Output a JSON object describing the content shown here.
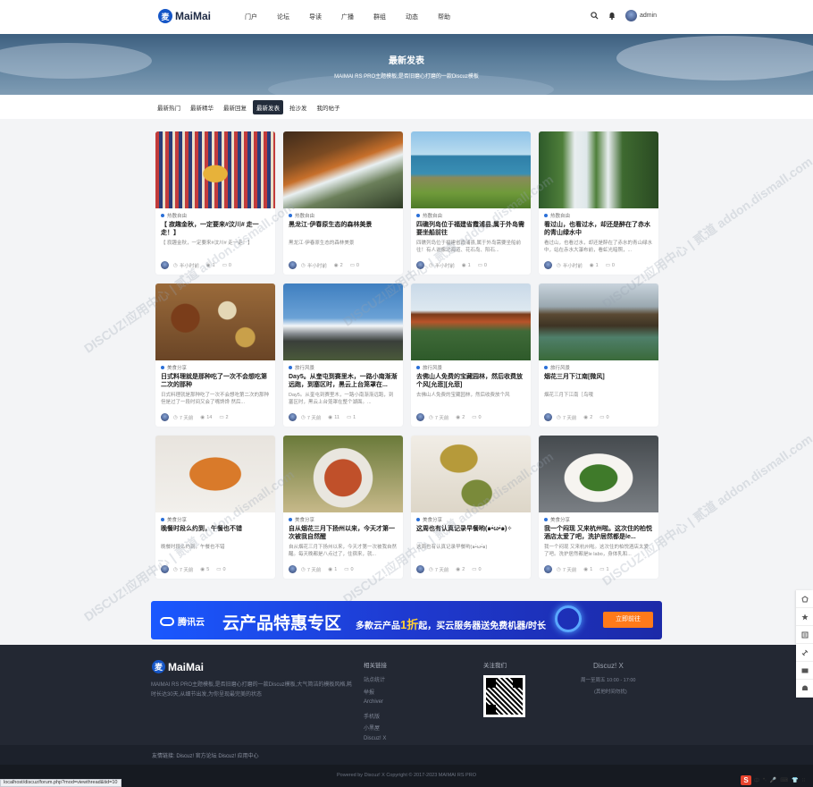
{
  "header": {
    "logo_text": "MaiMai",
    "logo_badge": "麦",
    "nav": [
      "门户",
      "论坛",
      "导读",
      "广播",
      "群组",
      "动态",
      "帮助"
    ],
    "user": "admin"
  },
  "banner": {
    "title": "最新发表",
    "subtitle": "MAIMAI RS PRO主题模板,是否旧磨心打磨的一款Discuz模板"
  },
  "tabs": [
    "最新热门",
    "最新精华",
    "最新回复",
    "最新发表",
    "抢沙发",
    "我的帖子"
  ],
  "active_tab": "最新发表",
  "cards": [
    {
      "category": "热敷自由",
      "title": "【 寂趣金秋，一定要来#汶川# 走一走！】",
      "excerpt": "【 寂趣金秋，一定要来#汶川# 走一走！】",
      "time": "半小时前",
      "views": "1",
      "replies": "0"
    },
    {
      "category": "热敷自由",
      "title": "黑龙江·伊春原生态的森林美景",
      "excerpt": "黑龙江·伊春原生态的森林美景",
      "time": "半小时前",
      "views": "2",
      "replies": "0"
    },
    {
      "category": "热敷自由",
      "title": "四礁列岛位于福建省霞浦县,属于外岛需要坐船前往",
      "excerpt": "四礁列岛位于福建省霞浦县,属于外岛需要坐船前往！有人说像北海道、花石岛、阳石...",
      "time": "半小时前",
      "views": "1",
      "replies": "0"
    },
    {
      "category": "热敷自由",
      "title": "看过山，也看过水，却还是醉在了赤水的青山绿水中",
      "excerpt": "看过山，也看过水，却还是醉在了赤水的青山绿水中，站在赤水大瀑布前，看虹光暗照，...",
      "time": "半小时前",
      "views": "1",
      "replies": "0"
    },
    {
      "category": "美食分享",
      "title": "日式料理就是那种吃了一次不会想吃第二次的那种",
      "excerpt": "日式料理就是那种吃了一次不会想吃第二次的那种 但是过了一段时间又会了嘴馋馋 然后...",
      "time": "7 天前",
      "views": "14",
      "replies": "2"
    },
    {
      "category": "旅行风景",
      "title": "Day5。从奎屯到赛里木，一路小南渐渐远跑，到塞区时，黑云上台笼罩在...",
      "excerpt": "Day5。从奎屯到赛里木，一路小南渐渐远跑，到塞区时，黑云上台笼罩在整个湖面。...",
      "time": "7 天前",
      "views": "11",
      "replies": "1"
    },
    {
      "category": "旅行风景",
      "title": "去佛山人免费的宝藏园林，然后收费放个风[允悲][允悲]",
      "excerpt": "去佛山人免费的宝藏园林，然后收费放个风",
      "time": "7 天前",
      "views": "2",
      "replies": "0"
    },
    {
      "category": "旅行风景",
      "title": "烟花三月下江南[微风]",
      "excerpt": "烟花三月下江南［鸟哦",
      "time": "7 天前",
      "views": "2",
      "replies": "0"
    },
    {
      "category": "美食分享",
      "title": "晚餐时段么约到，午餐也不错",
      "excerpt": "晚餐时段么约到，午餐也不错",
      "time": "7 天前",
      "views": "5",
      "replies": "0"
    },
    {
      "category": "美食分享",
      "title": "自从烟花三月下扬州以来，今天才第一次被我自然醒",
      "excerpt": "自从烟花三月下扬州以来，今天才第一次被我自然醒。每天晚都是八点过了，住宿来，就...",
      "time": "7 天前",
      "views": "1",
      "replies": "0"
    },
    {
      "category": "美食分享",
      "title": "这周也有认真记录早餐哟(๑•̀ω•́๑)✧",
      "excerpt": "这周也有认真记录早餐哟(๑•̀ω•́๑)",
      "time": "7 天前",
      "views": "2",
      "replies": "0"
    },
    {
      "category": "美食分享",
      "title": "我一个闷现 又来杭州啦。这次住的柏悦酒店太爱了吧，洗护居然都是le...",
      "excerpt": "我一个闷现 又来杭州啦。这次住的柏悦酒店太爱了吧。洗护居然都是le labo，身体乳和...",
      "time": "7 天前",
      "views": "1",
      "replies": "1"
    }
  ],
  "ad": {
    "brand": "腾讯云",
    "headline": "云产品特惠专区",
    "desc_prefix": "多款云产品",
    "desc_highlight": "1折",
    "desc_suffix": "起，买云服务器送免费机器/时长",
    "button": "立即前往"
  },
  "footer": {
    "logo_text": "MaiMai",
    "description": "MAIMAI RS PRO主题模板,是否旧磨心打磨的一款Discuz模板,大气简洁的模板风格,耗时长达30天,从细节出发,为你呈现最完美的状态",
    "links_title": "相关链接",
    "links": [
      "站点统计",
      "举报",
      "Archiver",
      "手机版",
      "小黑屋",
      "Discuz! X"
    ],
    "follow_title": "关注我们",
    "right_title": "Discuz! X",
    "right_hours": "周一至周五 10:00 - 17:00",
    "right_note": "(其他时间勿扰)"
  },
  "friend_links": "友情链接: Discuz! 官方论坛   Discuz! 应用中心",
  "copyright": "Powered by Discuz! X Copyright © 2017-2023 MAIMAI RS PRO",
  "status_url": "localhost/discuz/forum.php?mod=viewthread&tid=10",
  "ime_labels": [
    "中",
    "•,",
    "🎤",
    "⌨",
    "👕",
    "⁝⁝"
  ],
  "watermark": "DISCUZ!应用中心 | 贰道 addon.dismall.com",
  "colors": {
    "brand": "#1556c7",
    "active_tab": "#222b3a",
    "footer": "#232833",
    "ad_button": "#ff7a1a"
  }
}
